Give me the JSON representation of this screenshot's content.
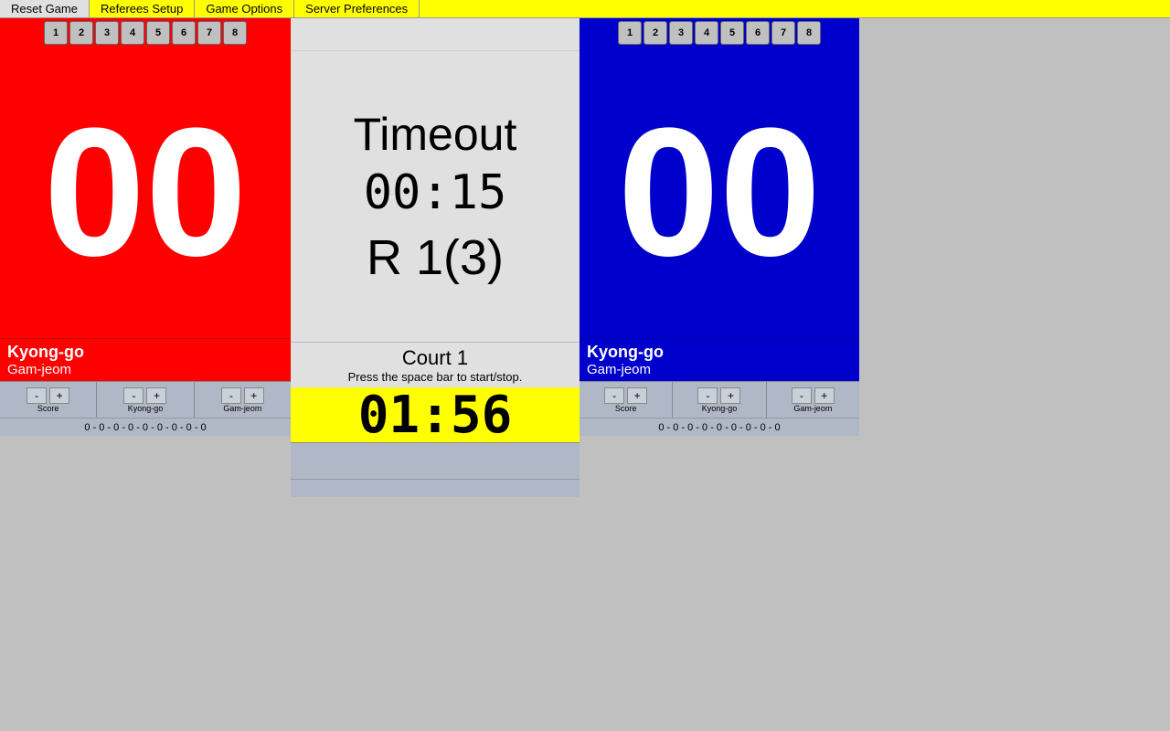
{
  "menu": {
    "items": [
      "Reset Game",
      "Referees Setup",
      "Game Options",
      "Server Preferences"
    ]
  },
  "left": {
    "rounds": [
      "1",
      "2",
      "3",
      "4",
      "5",
      "6",
      "7",
      "8"
    ],
    "score": "00",
    "kyong_go": "Kyong-go",
    "gam_jeom": "Gam-jeom",
    "ctrl_groups": [
      {
        "label": "Score",
        "minus": "-",
        "plus": "+"
      },
      {
        "label": "Kyong-go",
        "minus": "-",
        "plus": "+"
      },
      {
        "label": "Gam-jeom",
        "minus": "-",
        "plus": "+"
      }
    ],
    "numbers": "0 - 0 - 0 - 0 - 0 - 0 - 0 - 0 - 0"
  },
  "center": {
    "timeout_label": "Timeout",
    "timeout_time": "00:15",
    "round_display": "R 1(3)",
    "court": "Court 1",
    "hint": "Press the space bar to start/stop.",
    "game_timer": "01:56"
  },
  "right": {
    "rounds": [
      "1",
      "2",
      "3",
      "4",
      "5",
      "6",
      "7",
      "8"
    ],
    "score": "00",
    "kyong_go": "Kyong-go",
    "gam_jeom": "Gam-jeom",
    "ctrl_groups": [
      {
        "label": "Score",
        "minus": "-",
        "plus": "+"
      },
      {
        "label": "Kyong-go",
        "minus": "-",
        "plus": "+"
      },
      {
        "label": "Gam-jeom",
        "minus": "-",
        "plus": "+"
      }
    ],
    "numbers": "0 - 0 - 0 - 0 - 0 - 0 - 0 - 0 - 0"
  },
  "colors": {
    "menu_bg": "#ffff00",
    "left_bg": "#ff0000",
    "right_bg": "#0000cc",
    "center_bg": "#e0e0e0",
    "timer_bg": "#ffff00"
  }
}
